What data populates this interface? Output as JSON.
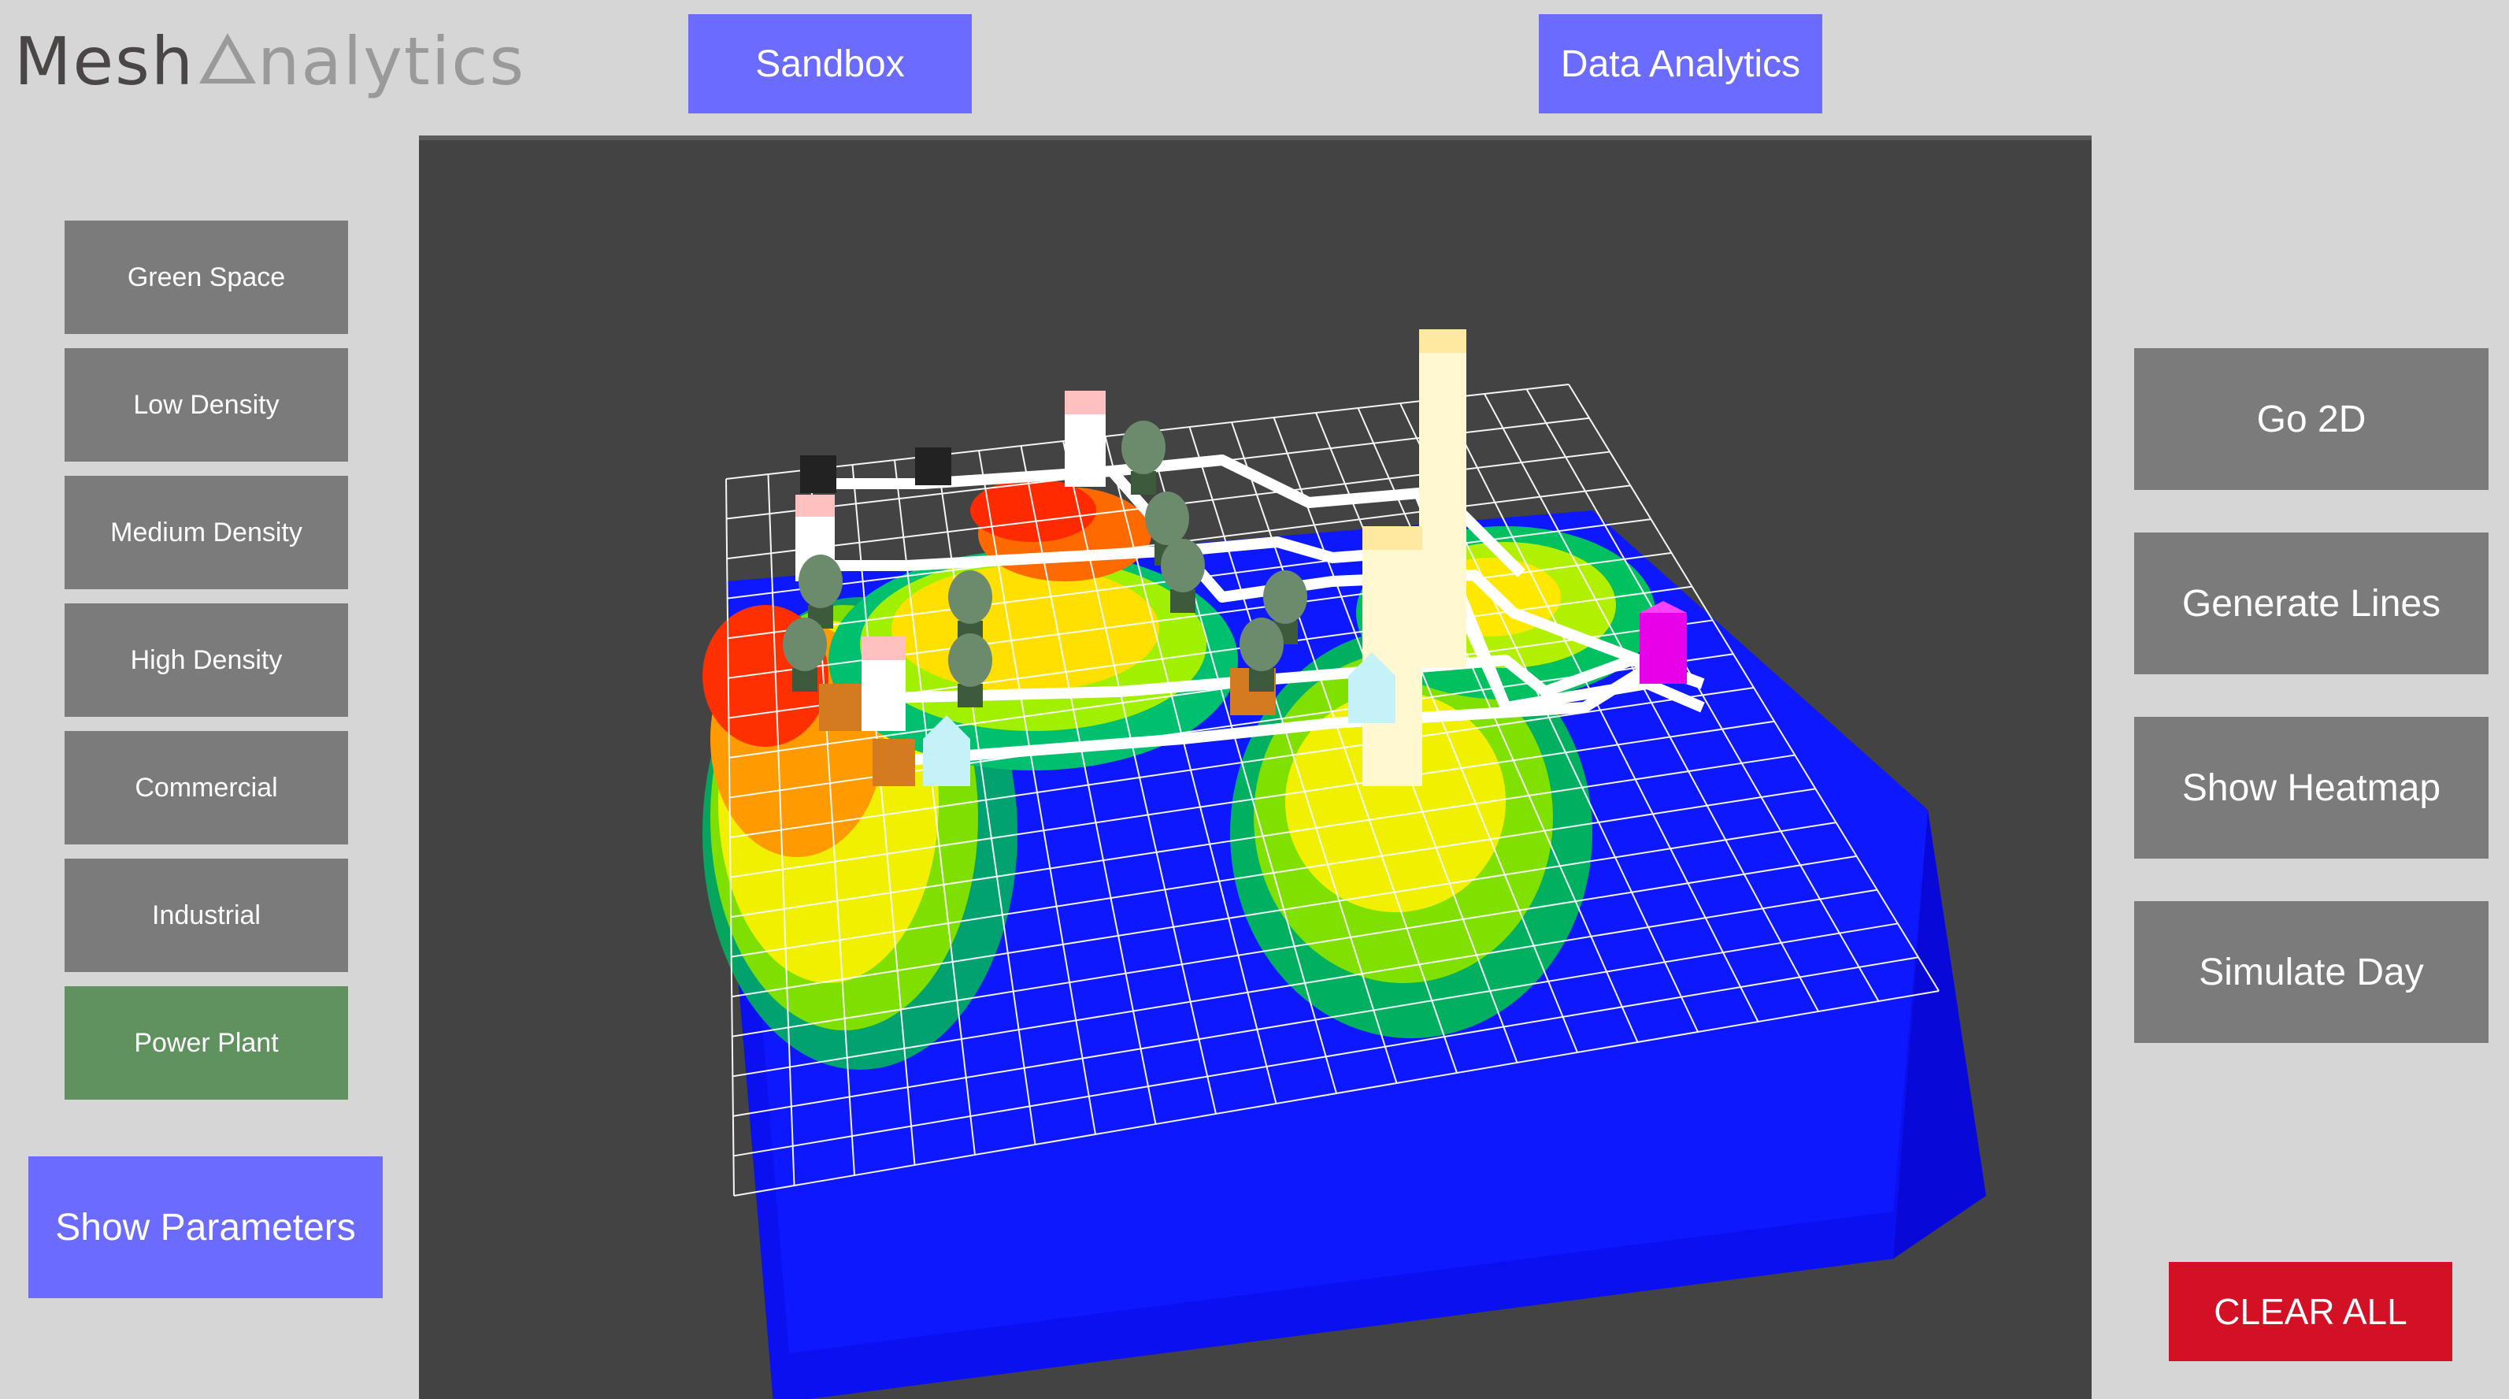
{
  "app": {
    "logo_dark": "Mesh ",
    "logo_light": "nalytics"
  },
  "top_nav": {
    "sandbox": "Sandbox",
    "data_analytics": "Data Analytics"
  },
  "zone_buttons": [
    {
      "label": "Green Space",
      "active": false
    },
    {
      "label": "Low Density",
      "active": false
    },
    {
      "label": "Medium Density",
      "active": false
    },
    {
      "label": "High Density",
      "active": false
    },
    {
      "label": "Commercial",
      "active": false
    },
    {
      "label": "Industrial",
      "active": false
    },
    {
      "label": "Power Plant",
      "active": true
    }
  ],
  "show_parameters": "Show Parameters",
  "right_buttons": {
    "go_2d": "Go 2D",
    "generate_lines": "Generate Lines",
    "show_heatmap": "Show Heatmap",
    "simulate_day": "Simulate Day"
  },
  "clear_all": "CLEAR ALL",
  "colors": {
    "accent": "#6b6bff",
    "panel_button": "#7b7b7b",
    "active_zone": "#5f925f",
    "danger": "#d31024",
    "viewport_bg": "#434343"
  }
}
